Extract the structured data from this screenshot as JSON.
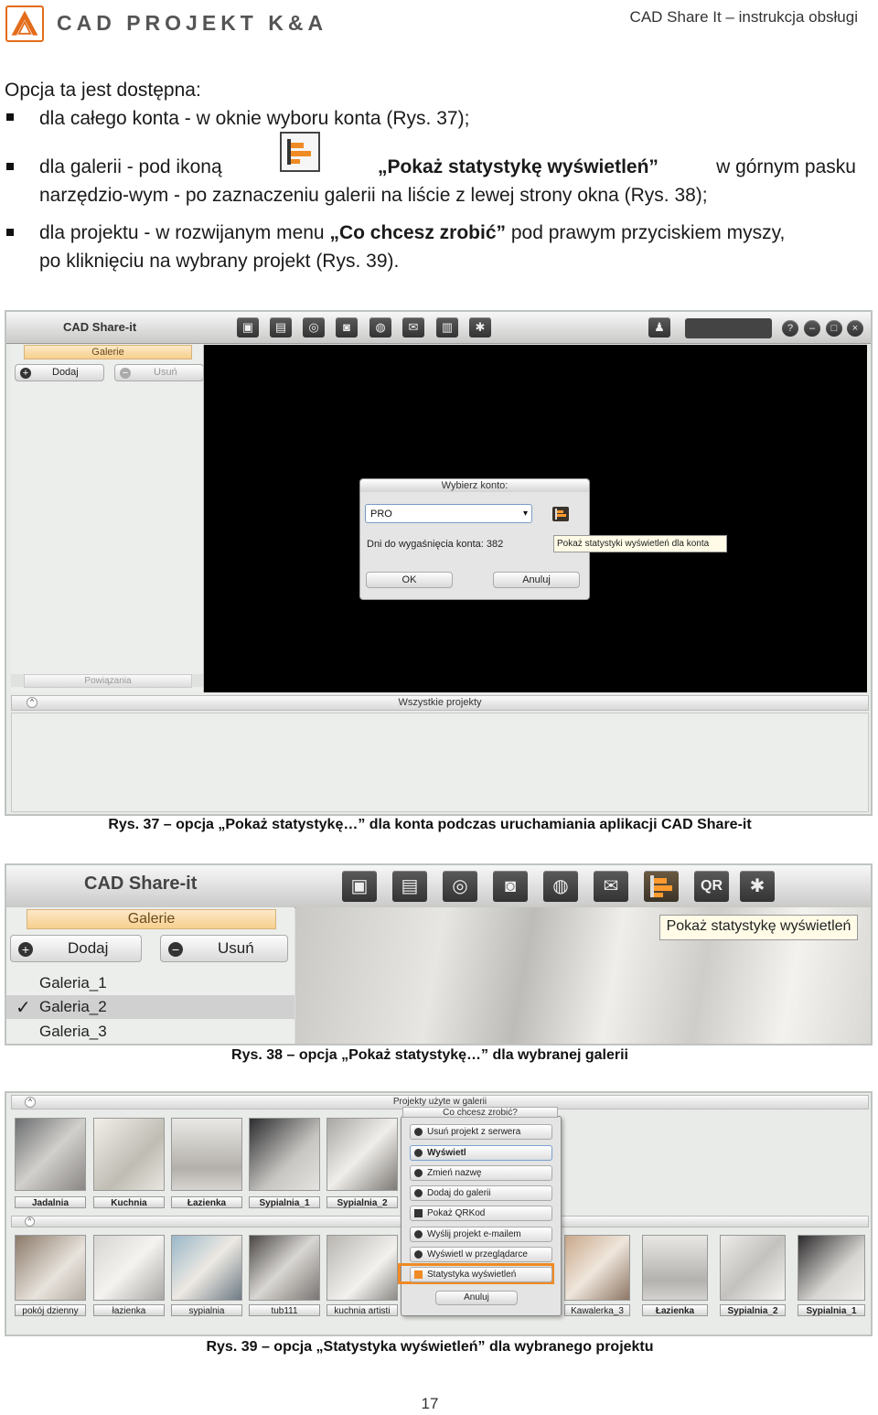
{
  "header": {
    "brand": "CAD PROJEKT K&A",
    "doc_title": "CAD Share It – instrukcja obsługi"
  },
  "intro": "Opcja ta jest dostępna:",
  "bullets": {
    "b1": "dla całego konta - w oknie wyboru konta (Rys. 37);",
    "b2_start": "dla galerii - pod ikoną",
    "b2_bold": "„Pokaż statystykę wyświetleń”",
    "b2_end": " w górnym pasku",
    "b2_line2": "narzędzio-wym - po zaznaczeniu galerii na liście z lewej strony okna (Rys. 38);",
    "b3_start": "dla projektu - w rozwijanym menu ",
    "b3_bold": "„Co chcesz zrobić”",
    "b3_end": " pod prawym przyciskiem myszy,",
    "b3_line2": "po kliknięciu na wybrany projekt (Rys. 39)."
  },
  "fig1": {
    "app_title": "CAD Share-it",
    "galerie": "Galerie",
    "dodaj": "Dodaj",
    "usun": "Usuń",
    "powiazania": "Powiązania",
    "wszystkie": "Wszystkie projekty",
    "dialog_title": "Wybierz konto:",
    "select_value": "PRO",
    "days_text": "Dni do wygaśnięcia konta: 382",
    "tooltip": "Pokaż statystyki wyświetleń dla konta",
    "ok": "OK",
    "anuluj": "Anuluj",
    "caption": "Rys. 37 – opcja „Pokaż statystykę…” dla konta podczas uruchamiania aplikacji CAD Share-it"
  },
  "fig2": {
    "app_title": "CAD Share-it",
    "galerie": "Galerie",
    "dodaj": "Dodaj",
    "usun": "Usuń",
    "tooltip": "Pokaż statystykę wyświetleń",
    "galleries": [
      "Galeria_1",
      "Galeria_2",
      "Galeria_3"
    ],
    "checkmark": "✓",
    "caption": "Rys. 38 – opcja „Pokaż statystykę…” dla wybranej galerii"
  },
  "fig3": {
    "panel_title": "Projekty użyte w galerii",
    "menu_title": "Co chcesz zrobić?",
    "top_thumbs": [
      "Jadalnia",
      "Kuchnia",
      "Łazienka",
      "Sypialnia_1",
      "Sypialnia_2"
    ],
    "bottom_thumbs_left": [
      "pokój dzienny",
      "łazienka",
      "sypialnia",
      "tub111",
      "kuchnia artisti"
    ],
    "bottom_thumbs_right": [
      "Kawalerka_3",
      "Łazienka",
      "Sypialnia_2",
      "Sypialnia_1"
    ],
    "menu": [
      "Usuń projekt z serwera",
      "Wyświetl",
      "Zmień nazwę",
      "Dodaj do galerii",
      "Pokaż QRKod",
      "Wyślij projekt e-mailem",
      "Wyświetl w przeglądarce",
      "Statystyka wyświetleń"
    ],
    "anuluj": "Anuluj",
    "caption": "Rys. 39 – opcja „Statystyka wyświetleń” dla wybranego projektu"
  },
  "page_number": "17",
  "colors": {
    "accent": "#e36c1a",
    "highlight": "#f08a24"
  }
}
